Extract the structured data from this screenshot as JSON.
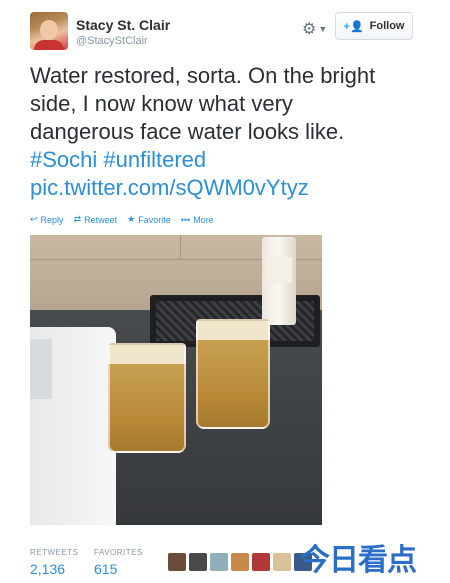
{
  "user": {
    "name": "Stacy St. Clair",
    "handle": "@StacyStClair",
    "avatar_icon": "user-avatar"
  },
  "header": {
    "gear_icon": "gear-icon",
    "chevron_icon": "chevron-down-icon",
    "follow_label": "Follow",
    "follow_icon": "add-user-icon"
  },
  "tweet": {
    "line1": "Water restored, sorta. On the bright",
    "line2": "side, I now know what very",
    "line3": "dangerous face water looks like.",
    "hashtag1": "#Sochi",
    "hashtag2": "#unfiltered",
    "link": "pic.twitter.com/sQWM0vYtyz"
  },
  "actions": {
    "reply": "Reply",
    "retweet": "Retweet",
    "favorite": "Favorite",
    "more": "More"
  },
  "stats": {
    "retweets_label": "RETWEETS",
    "retweets_value": "2,136",
    "favorites_label": "FAVORITES",
    "favorites_value": "615"
  },
  "colors": {
    "link": "#2b8fd6",
    "text": "#292f33",
    "muted": "#8899a6"
  },
  "watermark": {
    "brand": "今日看点"
  }
}
